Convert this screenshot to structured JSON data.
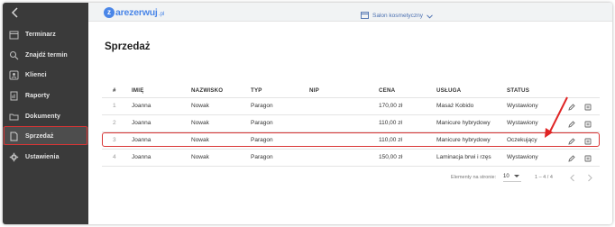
{
  "brand": {
    "logo_letter": "z",
    "logo_text": "arezerwuj",
    "logo_tld": ".pl",
    "accent": "#4a86e8",
    "highlight": "#d93535"
  },
  "topbar": {
    "salon_label": "Salon kosmetyczny",
    "salon_icon": "calendar-icon",
    "dropdown_icon": "chevron-down-icon"
  },
  "sidebar": {
    "back_icon": "chevron-left-icon",
    "items": [
      {
        "label": "Terminarz",
        "icon": "calendar-icon"
      },
      {
        "label": "Znajdź termin",
        "icon": "search-icon"
      },
      {
        "label": "Klienci",
        "icon": "users-icon"
      },
      {
        "label": "Raporty",
        "icon": "report-icon"
      },
      {
        "label": "Dokumenty",
        "icon": "folder-icon"
      },
      {
        "label": "Sprzedaż",
        "icon": "document-icon"
      },
      {
        "label": "Ustawienia",
        "icon": "gear-icon"
      }
    ],
    "active_index": 5
  },
  "page": {
    "title": "Sprzedaż"
  },
  "table": {
    "columns": [
      "#",
      "IMIĘ",
      "NAZWISKO",
      "TYP",
      "NIP",
      "CENA",
      "USŁUGA",
      "STATUS"
    ],
    "rows": [
      {
        "num": "1",
        "imie": "Joanna",
        "nazwisko": "Nowak",
        "typ": "Paragon",
        "nip": "",
        "cena": "170,00 zł",
        "usluga": "Masaż Kobido",
        "status": "Wystawiony"
      },
      {
        "num": "2",
        "imie": "Joanna",
        "nazwisko": "Nowak",
        "typ": "Paragon",
        "nip": "",
        "cena": "110,00 zł",
        "usluga": "Manicure hybrydowy",
        "status": "Wystawiony"
      },
      {
        "num": "3",
        "imie": "Joanna",
        "nazwisko": "Nowak",
        "typ": "Paragon",
        "nip": "",
        "cena": "110,00 zł",
        "usluga": "Manicure hybrydowy",
        "status": "Oczekujący"
      },
      {
        "num": "4",
        "imie": "Joanna",
        "nazwisko": "Nowak",
        "typ": "Paragon",
        "nip": "",
        "cena": "150,00 zł",
        "usluga": "Laminacja brwi i rzęs",
        "status": "Wystawiony"
      }
    ],
    "highlighted_row": 2,
    "row_actions": [
      "edit-icon",
      "receipt-icon"
    ]
  },
  "pagination": {
    "label": "Elementy na stronie:",
    "page_size": "10",
    "range": "1 – 4 / 4"
  }
}
